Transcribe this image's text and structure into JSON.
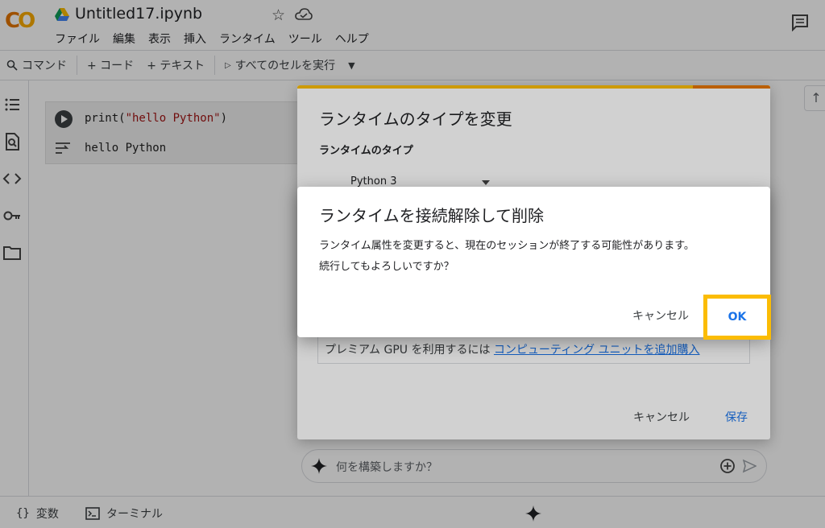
{
  "app": {
    "logo_text": "CO",
    "doc_title": "Untitled17.ipynb"
  },
  "menu": [
    "ファイル",
    "編集",
    "表示",
    "挿入",
    "ランタイム",
    "ツール",
    "ヘルプ"
  ],
  "toolbar": {
    "command_label": "コマンド",
    "add_code_label": "+ コード",
    "add_text_label": "+ テキスト",
    "run_all_label": "すべてのセルを実行"
  },
  "cell": {
    "code_fn": "print(",
    "code_str": "\"hello Python\"",
    "code_end": ")",
    "output": "hello Python"
  },
  "prompt": {
    "placeholder": "何を構築しますか？"
  },
  "statusbar": {
    "variables_label": "変数",
    "terminal_label": "ターミナル"
  },
  "runtime_dialog": {
    "title": "ランタイムのタイプを変更",
    "runtime_type_label": "ランタイムのタイプ",
    "runtime_type_value": "Python 3",
    "premium_text": "プレミアム GPU を利用するには",
    "premium_link": "コンピューティング ユニットを追加購入",
    "cancel_label": "キャンセル",
    "save_label": "保存"
  },
  "confirm_dialog": {
    "title": "ランタイムを接続解除して削除",
    "body_line1": "ランタイム属性を変更すると、現在のセッションが終了する可能性があります。",
    "body_line2": "続行してもよろしいですか？",
    "cancel_label": "キャンセル",
    "ok_label": "OK"
  },
  "colors": {
    "accent": "#1a73e8",
    "highlight": "#fbbc04",
    "logo_orange": "#e37400"
  }
}
